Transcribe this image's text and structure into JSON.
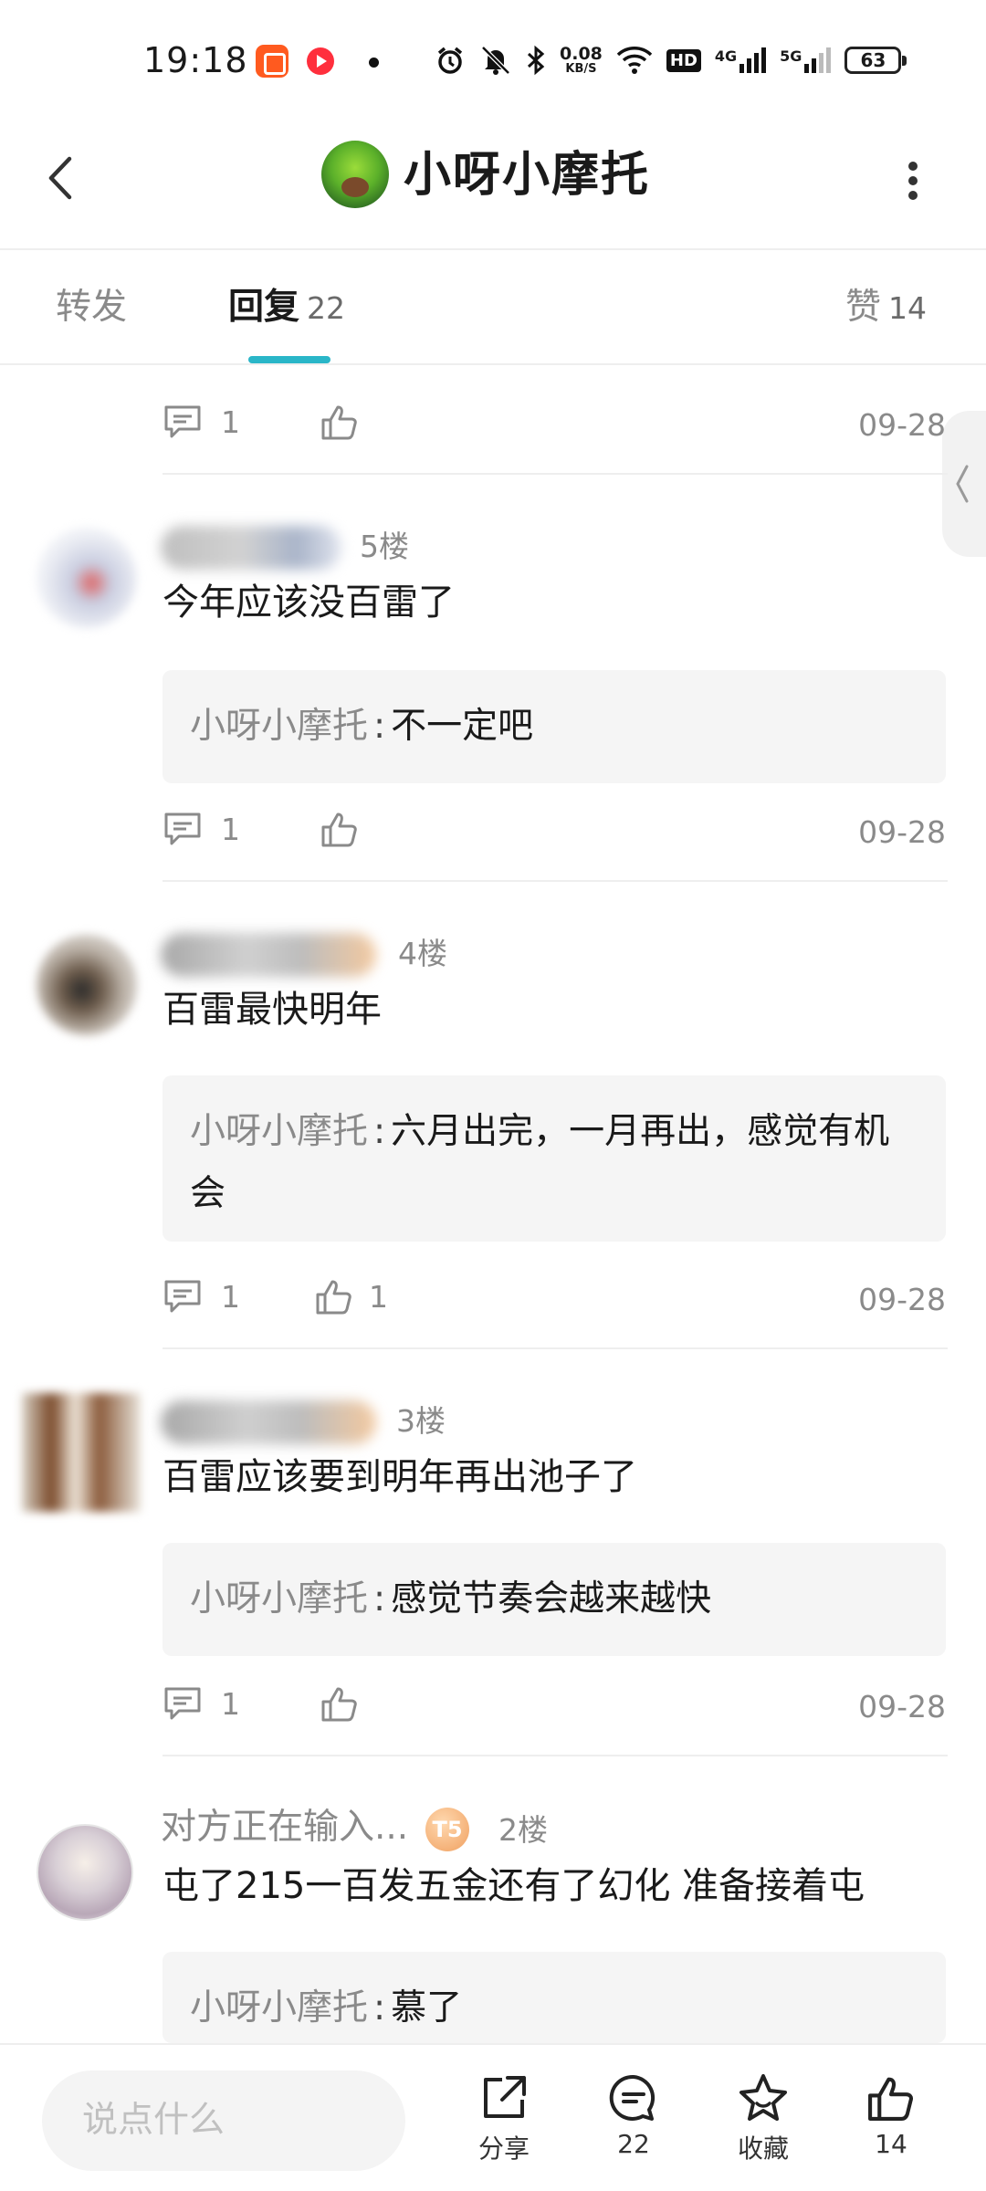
{
  "status_bar": {
    "time": "19:18",
    "net_speed": "0.08",
    "net_unit": "KB/S",
    "hd_label": "HD",
    "sig1_label": "4G",
    "sig2_label": "5G",
    "battery": "63"
  },
  "header": {
    "title": "小呀小摩托"
  },
  "tabs": {
    "repost": "转发",
    "reply": "回复",
    "reply_count": "22",
    "like": "赞",
    "like_count": "14"
  },
  "comments": [
    {
      "comment_count": "1",
      "like_count": "",
      "date": "09-28"
    },
    {
      "floor": "5楼",
      "text": "今年应该没百雷了",
      "reply_name": "小呀小摩托",
      "reply_sep": ":",
      "reply_text": "不一定吧",
      "comment_count": "1",
      "like_count": "",
      "date": "09-28"
    },
    {
      "floor": "4楼",
      "text": "百雷最快明年",
      "reply_name": "小呀小摩托",
      "reply_sep": ":",
      "reply_text": "六月出完，一月再出，感觉有机会",
      "comment_count": "1",
      "like_count": "1",
      "date": "09-28"
    },
    {
      "floor": "3楼",
      "text": "百雷应该要到明年再出池子了",
      "reply_name": "小呀小摩托",
      "reply_sep": ":",
      "reply_text": "感觉节奏会越来越快",
      "comment_count": "1",
      "like_count": "",
      "date": "09-28"
    },
    {
      "username": "对方正在输入...",
      "level": "T5",
      "floor": "2楼",
      "text": "屯了215一百发五金还有了幻化 准备接着屯",
      "reply_name": "小呀小摩托",
      "reply_sep": ":",
      "reply_text": "慕了"
    }
  ],
  "bottom_bar": {
    "input_placeholder": "说点什么",
    "share_label": "分享",
    "comment_count": "22",
    "favorite_label": "收藏",
    "like_count": "14"
  },
  "colors": {
    "accent": "#2ab6c8",
    "muted_text": "#8a8a8a",
    "reply_bg": "#f5f5f5"
  }
}
